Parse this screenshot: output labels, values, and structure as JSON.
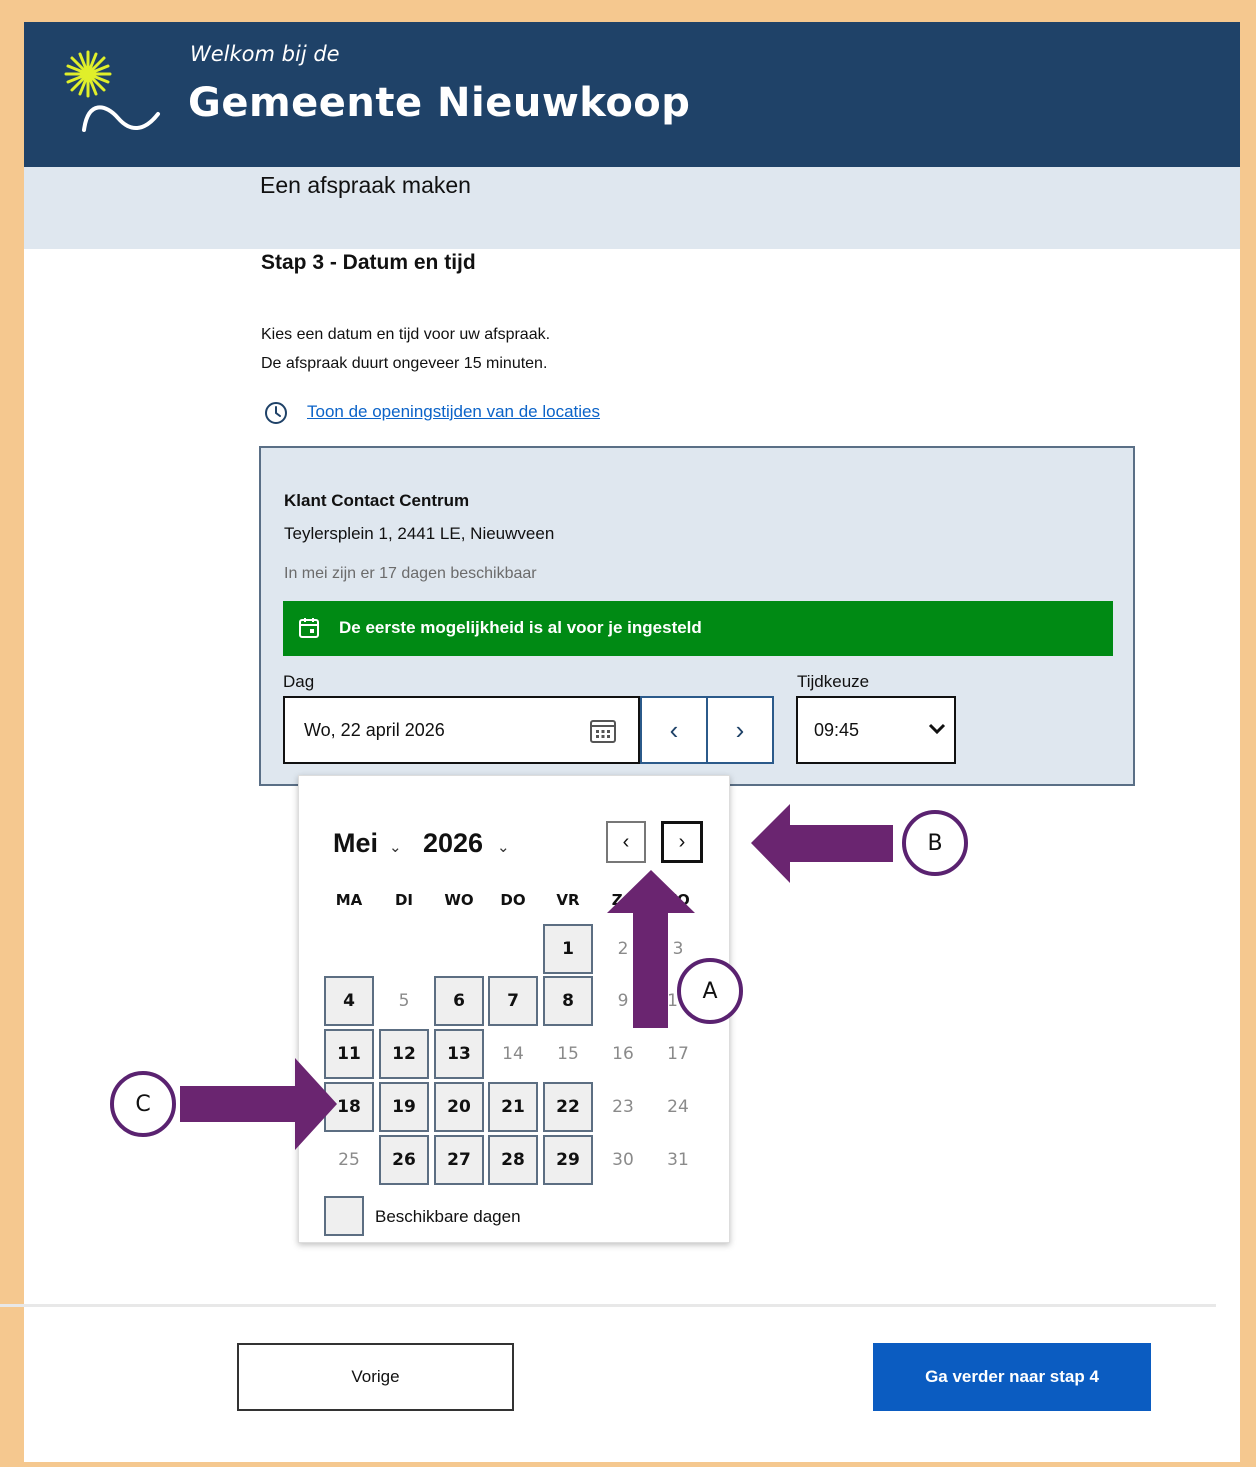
{
  "header": {
    "welcome": "Welkom bij de",
    "municipality": "Gemeente Nieuwkoop"
  },
  "subheader": {
    "title": "Een afspraak maken"
  },
  "step": {
    "title": "Stap 3 - Datum en tijd",
    "intro_line1": "Kies een datum en tijd voor uw afspraak.",
    "intro_line2": "De afspraak duurt ongeveer 15 minuten.",
    "hours_link": "Toon de openingstijden van de locaties"
  },
  "location": {
    "name": "Klant Contact Centrum",
    "address": "Teylersplein 1, 2441 LE, Nieuwveen",
    "availability": "In mei zijn er 17 dagen beschikbaar",
    "notice": "De eerste mogelijkheid is al voor je ingesteld",
    "notice_color": "#008a14"
  },
  "date_picker": {
    "day_label": "Dag",
    "day_value": "Wo, 22 april 2026",
    "prev_day": "‹",
    "next_day": "›",
    "time_label": "Tijdkeuze",
    "time_value": "09:45"
  },
  "calendar": {
    "month": "Mei",
    "year": "2026",
    "prev": "‹",
    "next": "›",
    "weekdays": [
      "MA",
      "DI",
      "WO",
      "DO",
      "VR",
      "ZA",
      "ZO"
    ],
    "legend": "Beschikbare dagen",
    "days": [
      {
        "n": "1",
        "col": 4,
        "row": 0,
        "available": true
      },
      {
        "n": "2",
        "col": 5,
        "row": 0,
        "available": false
      },
      {
        "n": "3",
        "col": 6,
        "row": 0,
        "available": false
      },
      {
        "n": "4",
        "col": 0,
        "row": 1,
        "available": true
      },
      {
        "n": "5",
        "col": 1,
        "row": 1,
        "available": false
      },
      {
        "n": "6",
        "col": 2,
        "row": 1,
        "available": true
      },
      {
        "n": "7",
        "col": 3,
        "row": 1,
        "available": true
      },
      {
        "n": "8",
        "col": 4,
        "row": 1,
        "available": true
      },
      {
        "n": "9",
        "col": 5,
        "row": 1,
        "available": false
      },
      {
        "n": "10",
        "col": 6,
        "row": 1,
        "available": false
      },
      {
        "n": "11",
        "col": 0,
        "row": 2,
        "available": true
      },
      {
        "n": "12",
        "col": 1,
        "row": 2,
        "available": true
      },
      {
        "n": "13",
        "col": 2,
        "row": 2,
        "available": true
      },
      {
        "n": "14",
        "col": 3,
        "row": 2,
        "available": false
      },
      {
        "n": "15",
        "col": 4,
        "row": 2,
        "available": false
      },
      {
        "n": "16",
        "col": 5,
        "row": 2,
        "available": false
      },
      {
        "n": "17",
        "col": 6,
        "row": 2,
        "available": false
      },
      {
        "n": "18",
        "col": 0,
        "row": 3,
        "available": true
      },
      {
        "n": "19",
        "col": 1,
        "row": 3,
        "available": true
      },
      {
        "n": "20",
        "col": 2,
        "row": 3,
        "available": true
      },
      {
        "n": "21",
        "col": 3,
        "row": 3,
        "available": true
      },
      {
        "n": "22",
        "col": 4,
        "row": 3,
        "available": true
      },
      {
        "n": "23",
        "col": 5,
        "row": 3,
        "available": false
      },
      {
        "n": "24",
        "col": 6,
        "row": 3,
        "available": false
      },
      {
        "n": "25",
        "col": 0,
        "row": 4,
        "available": false
      },
      {
        "n": "26",
        "col": 1,
        "row": 4,
        "available": true
      },
      {
        "n": "27",
        "col": 2,
        "row": 4,
        "available": true
      },
      {
        "n": "28",
        "col": 3,
        "row": 4,
        "available": true
      },
      {
        "n": "29",
        "col": 4,
        "row": 4,
        "available": true
      },
      {
        "n": "30",
        "col": 5,
        "row": 4,
        "available": false
      },
      {
        "n": "31",
        "col": 6,
        "row": 4,
        "available": false
      }
    ]
  },
  "footer": {
    "prev_button": "Vorige",
    "next_button": "Ga verder naar stap 4"
  },
  "annotations": {
    "marker_a": "A",
    "marker_b": "B",
    "marker_c": "C",
    "arrow_color": "#6a2570"
  }
}
